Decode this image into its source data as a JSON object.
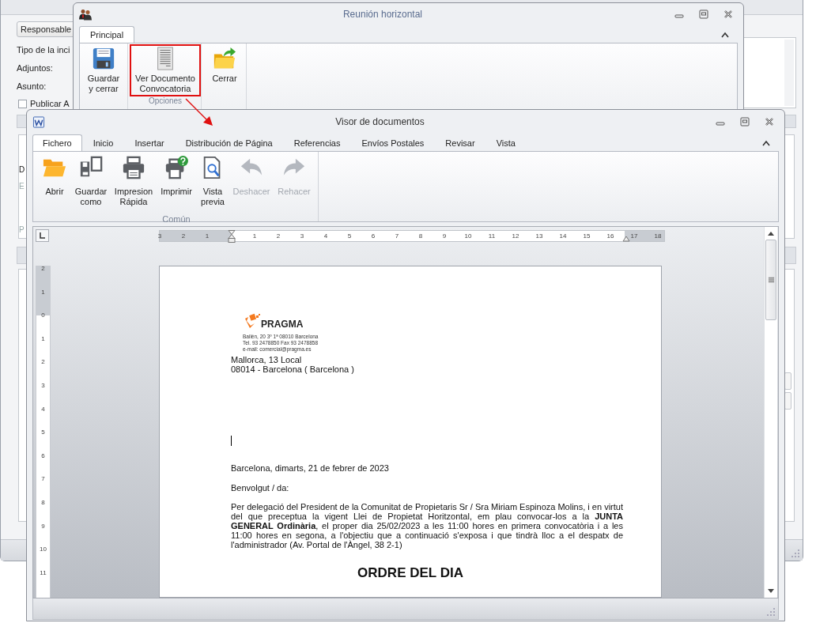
{
  "background_window": {
    "responsable_button": "Responsable",
    "form_labels": [
      "Tipo de la inci",
      "Adjuntos:",
      "Asunto:"
    ],
    "publish_checkbox": {
      "label": "Publicar A",
      "checked": false
    },
    "panel_fragments": [
      {
        "text": "D",
        "disabled": false
      },
      {
        "text": "E",
        "disabled": true
      },
      {
        "text": "P",
        "disabled": true
      }
    ]
  },
  "meeting_window": {
    "title": "Reunión horizontal",
    "tabs": [
      {
        "label": "Principal",
        "selected": true
      }
    ],
    "buttons": [
      {
        "label": "Guardar y cerrar",
        "highlighted": false
      },
      {
        "label": "Ver Documento Convocatoria",
        "highlighted": true
      },
      {
        "label": "Cerrar",
        "highlighted": false
      }
    ],
    "group_label": "Opciones"
  },
  "document_window": {
    "title": "Visor de documentos",
    "tabs": [
      {
        "label": "Fichero",
        "selected": true
      },
      {
        "label": "Inicio",
        "selected": false
      },
      {
        "label": "Insertar",
        "selected": false
      },
      {
        "label": "Distribución de Página",
        "selected": false
      },
      {
        "label": "Referencias",
        "selected": false
      },
      {
        "label": "Envíos Postales",
        "selected": false
      },
      {
        "label": "Revisar",
        "selected": false
      },
      {
        "label": "Vista",
        "selected": false
      }
    ],
    "buttons": [
      {
        "label": "Abrir",
        "disabled": false
      },
      {
        "label": "Guardar como",
        "disabled": false
      },
      {
        "label": "Impresion Rápida",
        "disabled": false
      },
      {
        "label": "Imprimir",
        "disabled": false
      },
      {
        "label": "Vista previa",
        "disabled": false
      },
      {
        "label": "Deshacer",
        "disabled": true
      },
      {
        "label": "Rehacer",
        "disabled": true
      }
    ],
    "group_label": "Común",
    "horizontal_ruler": [
      "3",
      "2",
      "1",
      "1",
      "2",
      "3",
      "4",
      "5",
      "6",
      "7",
      "8",
      "9",
      "10",
      "11",
      "12",
      "13",
      "14",
      "15",
      "16",
      "17",
      "18"
    ],
    "vertical_ruler": [
      "2",
      "1",
      "0",
      "1",
      "2",
      "3",
      "4",
      "5",
      "6",
      "7",
      "8",
      "9",
      "10",
      "11"
    ],
    "page": {
      "logo_text": "PRAGMA",
      "logo_address": [
        "Bailén, 20 3º 1ª 08010 Barcelona",
        "Tel. 93 2478850 Fax 93 2478858",
        "e-mail: comercial@pragma.es"
      ],
      "address": [
        "Mallorca, 13 Local",
        "08014 - Barcelona ( Barcelona )"
      ],
      "date_line": "Barcelona, dimarts, 21 de febrer de 2023",
      "greeting": "Benvolgut / da:",
      "body": "Per delegació del President de la Comunitat de Propietaris Sr / Sra Miriam Espinoza Molins, i en virtut del que preceptua la vigent Llei de Propietat Horitzontal, em plau convocar-los a la **JUNTA GENERAL Ordinària**, el proper dia 25/02/2023 a les 11:00 hores en primera convocatòria i a les 11:00 hores en segona, a l'objectiu que a continuació s'exposa i que tindrà lloc a el despatx de l'administrador (Av. Portal de l'Àngel, 38 2-1)",
      "heading": "ORDRE DEL DIA"
    }
  }
}
